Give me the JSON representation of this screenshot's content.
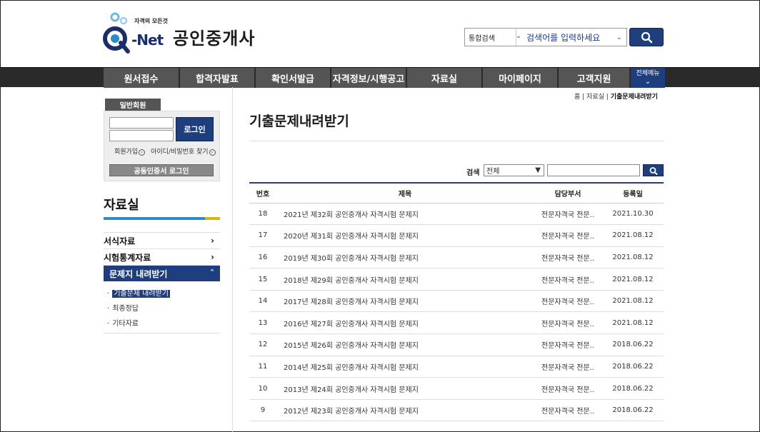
{
  "header": {
    "logo_tag": "자격의 모든것",
    "logo_net": "-Net",
    "site_title": "공인중개사",
    "search_scope": "통합검색",
    "search_placeholder": "검색어를 입력하세요"
  },
  "nav": {
    "items": [
      "원서접수",
      "합격자발표",
      "확인서발급",
      "자격정보/시행공고",
      "자료실",
      "마이페이지",
      "고객지원"
    ],
    "all_menu": "전체메뉴"
  },
  "login": {
    "member_tab": "일반회원",
    "login_button": "로그인",
    "signup": "회원가입",
    "find_account": "아이디/비밀번호 찾기",
    "cert_login": "공동인증서 로그인"
  },
  "sidebar": {
    "title": "자료실",
    "menu": [
      {
        "label": "서식자료",
        "chevron": "›"
      },
      {
        "label": "시험통계자료",
        "chevron": "›"
      },
      {
        "label": "문제지 내려받기",
        "chevron": "ˆ"
      }
    ],
    "submenu": [
      "기출문제 내려받기",
      "최종정답",
      "기타자료"
    ]
  },
  "breadcrumb": {
    "home": "홈",
    "section": "자료실",
    "current": "기출문제내려받기",
    "sep": "|"
  },
  "page_title": "기출문제내려받기",
  "filter": {
    "label": "검색",
    "select_value": "전체"
  },
  "table": {
    "headers": {
      "num": "번호",
      "title": "제목",
      "dept": "담당부서",
      "date": "등록일"
    },
    "rows": [
      {
        "num": "18",
        "title": "2021년 제32회 공인중개사 자격시험 문제지",
        "dept": "전문자격국 전문..",
        "date": "2021.10.30"
      },
      {
        "num": "17",
        "title": "2020년 제31회 공인중개사 자격시험 문제지",
        "dept": "전문자격국 전문..",
        "date": "2021.08.12"
      },
      {
        "num": "16",
        "title": "2019년 제30회 공인중개사 자격시험 문제지",
        "dept": "전문자격국 전문..",
        "date": "2021.08.12"
      },
      {
        "num": "15",
        "title": "2018년 제29회 공인중개사 자격시험 문제지",
        "dept": "전문자격국 전문..",
        "date": "2021.08.12"
      },
      {
        "num": "14",
        "title": "2017년 제28회 공인중개사 자격시험 문제지",
        "dept": "전문자격국 전문..",
        "date": "2021.08.12"
      },
      {
        "num": "13",
        "title": "2016년 제27회 공인중개사 자격시험 문제지",
        "dept": "전문자격국 전문..",
        "date": "2021.08.12"
      },
      {
        "num": "12",
        "title": "2015년 제26회 공인중개사 자격시험 문제지",
        "dept": "전문자격국 전문..",
        "date": "2018.06.22"
      },
      {
        "num": "11",
        "title": "2014년 제25회 공인중개사 자격시험 문제지",
        "dept": "전문자격국 전문..",
        "date": "2018.06.22"
      },
      {
        "num": "10",
        "title": "2013년 제24회 공인중개사 자격시험 문제지",
        "dept": "전문자격국 전문..",
        "date": "2018.06.22"
      },
      {
        "num": "9",
        "title": "2012년 제23회 공인중개사 자격시험 문제지",
        "dept": "전문자격국 전문..",
        "date": "2018.06.22"
      }
    ]
  },
  "colors": {
    "brand_navy": "#1e3e7d",
    "nav_gray": "#555555",
    "accent_blue": "#2a8fc8",
    "accent_yellow": "#e0b400"
  }
}
